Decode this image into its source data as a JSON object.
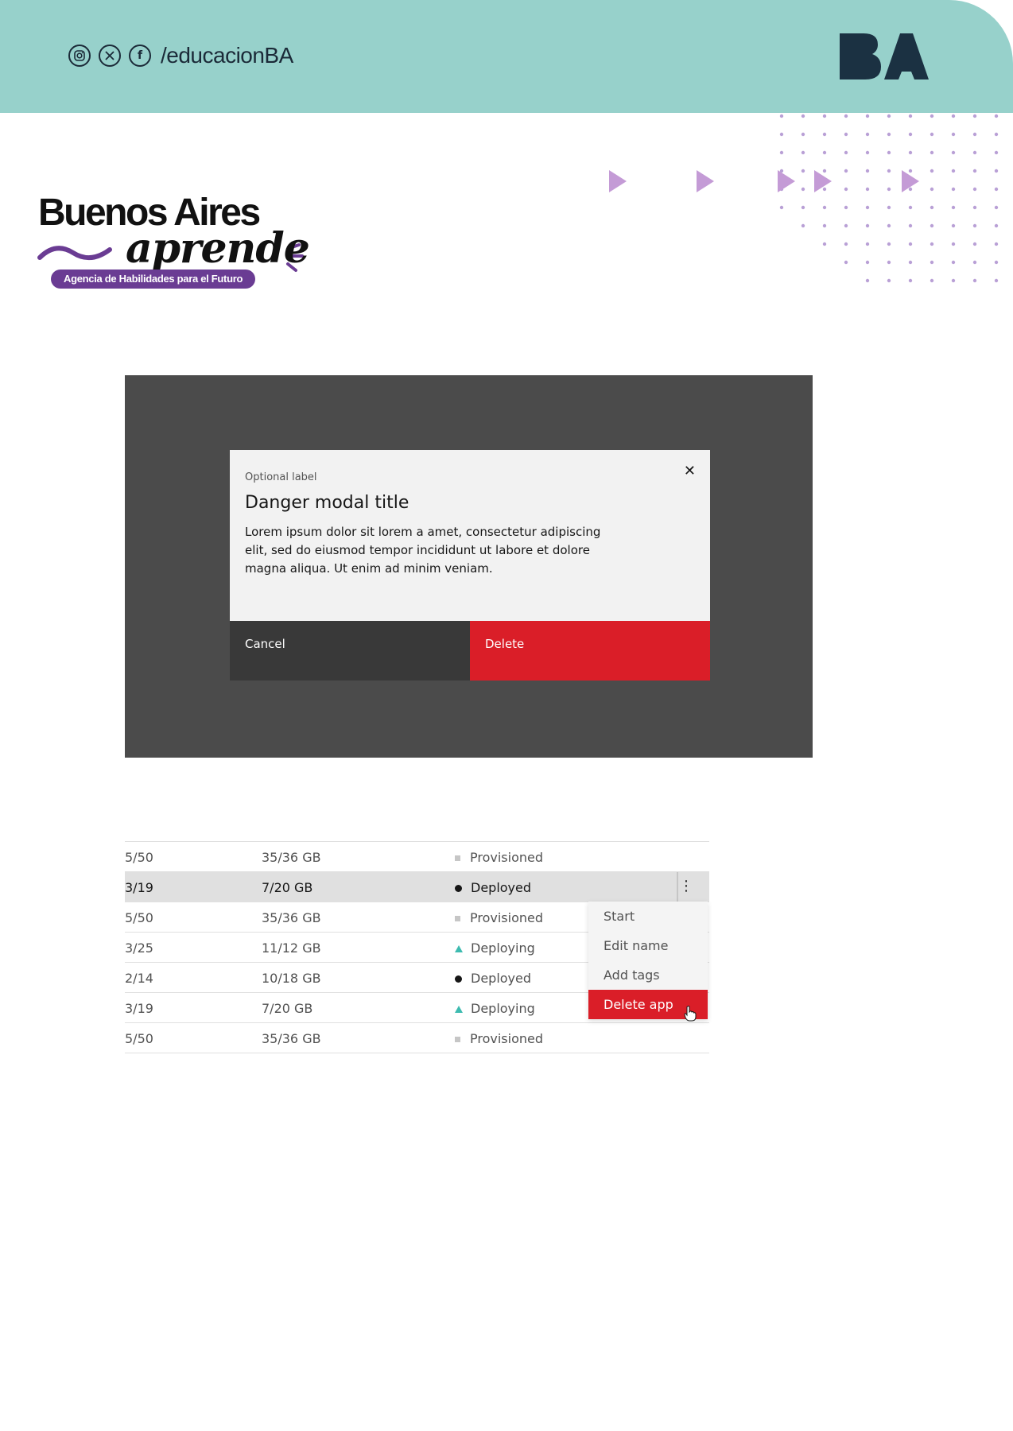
{
  "header": {
    "social_icons": [
      "instagram-icon",
      "x-icon",
      "facebook-icon"
    ],
    "handle": "/educacionBA",
    "logo_text": "BA",
    "colors": {
      "band": "#97d1cb",
      "ink": "#1b2a38"
    }
  },
  "brand": {
    "title": "Buenos Aires",
    "script": "aprende",
    "tagline": "Agencia de Habilidades para el Futuro",
    "accent": "#6a3c93"
  },
  "modal": {
    "label": "Optional label",
    "title": "Danger modal title",
    "body": "Lorem ipsum dolor sit lorem a amet, consectetur adipiscing elit, sed do eiusmod tempor incididunt ut labore et dolore magna aliqua. Ut enim ad minim veniam.",
    "close_icon": "close-icon",
    "cancel_label": "Cancel",
    "delete_label": "Delete",
    "danger_color": "#da1e28"
  },
  "table": {
    "rows": [
      {
        "ratio": "5/50",
        "storage": "35/36 GB",
        "status": "Provisioned",
        "status_icon": "square"
      },
      {
        "ratio": "3/19",
        "storage": "7/20 GB",
        "status": "Deployed",
        "status_icon": "dot"
      },
      {
        "ratio": "5/50",
        "storage": "35/36 GB",
        "status": "Provisioned",
        "status_icon": "square"
      },
      {
        "ratio": "3/25",
        "storage": "11/12 GB",
        "status": "Deploying",
        "status_icon": "triangle"
      },
      {
        "ratio": "2/14",
        "storage": "10/18 GB",
        "status": "Deployed",
        "status_icon": "dot"
      },
      {
        "ratio": "3/19",
        "storage": "7/20 GB",
        "status": "Deploying",
        "status_icon": "triangle"
      },
      {
        "ratio": "5/50",
        "storage": "35/36 GB",
        "status": "Provisioned",
        "status_icon": "square"
      }
    ],
    "overflow_menu": [
      "Start",
      "Edit name",
      "Add tags",
      "Delete app"
    ]
  }
}
